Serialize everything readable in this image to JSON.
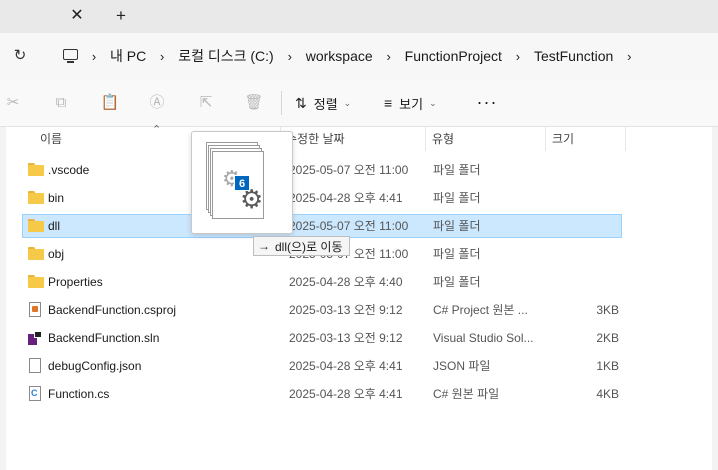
{
  "tabs": {
    "close_glyph": "✕",
    "new_glyph": "+"
  },
  "address": {
    "refresh_glyph": "↻",
    "sep_glyph": "›",
    "crumbs": [
      "내 PC",
      "로컬 디스크 (C:)",
      "workspace",
      "FunctionProject",
      "TestFunction"
    ]
  },
  "commands": {
    "cut_glyph": "✂",
    "copy_glyph": "⧉",
    "paste_glyph": "📋",
    "rename_glyph": "Ⓐ",
    "share_glyph": "⇱",
    "delete_glyph": "🗑",
    "sort_glyph": "⇅",
    "sort_label": "정렬",
    "view_glyph": "≡",
    "view_label": "보기",
    "caret_glyph": "⌄",
    "more_glyph": "···"
  },
  "columns": {
    "name": "이름",
    "modified": "수정한 날짜",
    "type": "유형",
    "size": "크기",
    "sort_glyph": "⌃"
  },
  "files": [
    {
      "name": ".vscode",
      "modified": "2025-05-07 오전 11:00",
      "type": "파일 폴더",
      "size": "",
      "icon": "folder-icon"
    },
    {
      "name": "bin",
      "modified": "2025-04-28 오후 4:41",
      "type": "파일 폴더",
      "size": "",
      "icon": "folder-icon"
    },
    {
      "name": "dll",
      "modified": "2025-05-07 오전 11:00",
      "type": "파일 폴더",
      "size": "",
      "icon": "folder-icon"
    },
    {
      "name": "obj",
      "modified": "2025-05-07 오전 11:00",
      "type": "파일 폴더",
      "size": "",
      "icon": "folder-icon"
    },
    {
      "name": "Properties",
      "modified": "2025-04-28 오후 4:40",
      "type": "파일 폴더",
      "size": "",
      "icon": "folder-icon"
    },
    {
      "name": "BackendFunction.csproj",
      "modified": "2025-03-13 오전 9:12",
      "type": "C# Project 원본 ...",
      "size": "3KB",
      "icon": "csproj-icon"
    },
    {
      "name": "BackendFunction.sln",
      "modified": "2025-03-13 오전 9:12",
      "type": "Visual Studio Sol...",
      "size": "2KB",
      "icon": "sln-icon"
    },
    {
      "name": "debugConfig.json",
      "modified": "2025-04-28 오후 4:41",
      "type": "JSON 파일",
      "size": "1KB",
      "icon": "json-file-icon"
    },
    {
      "name": "Function.cs",
      "modified": "2025-04-28 오후 4:41",
      "type": "C# 원본 파일",
      "size": "4KB",
      "icon": "cs-file-icon"
    }
  ],
  "drag": {
    "count": "6",
    "tooltip_arrow": "→",
    "tooltip": "dll(으)로 이동",
    "gear_glyph": "⚙"
  }
}
